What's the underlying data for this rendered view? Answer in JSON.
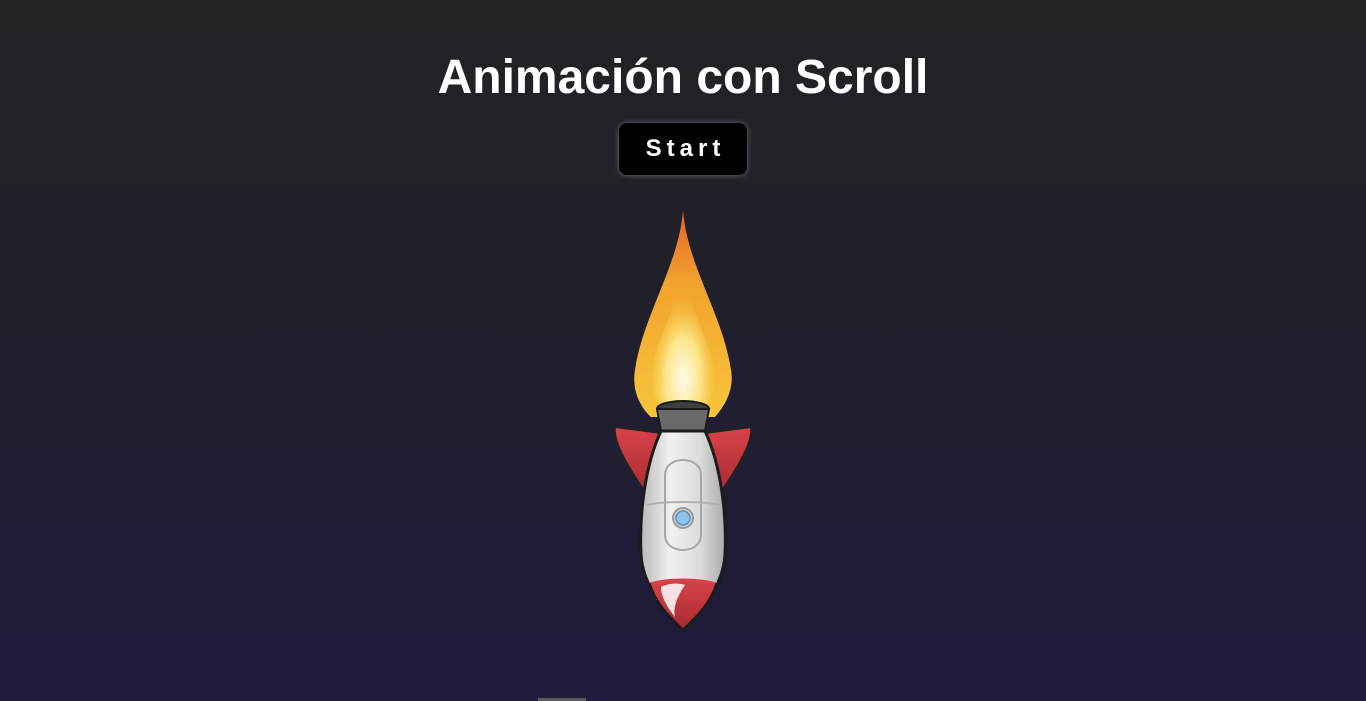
{
  "header": {
    "title": "Animación con Scroll"
  },
  "controls": {
    "start_label": "Start"
  },
  "scene": {
    "rocket_icon": "rocket-icon",
    "flame_icon": "flame-icon"
  },
  "colors": {
    "background_top": "#232323",
    "background_bottom": "#1e1b3c",
    "button_bg": "#000000",
    "text": "#ffffff",
    "rocket_fin": "#c8353c",
    "rocket_body": "#d9d9d9",
    "flame": "#f5b52e"
  }
}
